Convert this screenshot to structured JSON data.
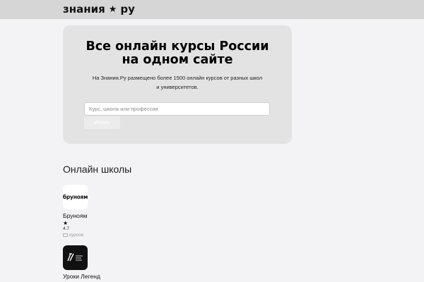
{
  "header": {
    "logo_left": "знания",
    "logo_star": "★",
    "logo_right": "ру"
  },
  "hero": {
    "title_line1": "Все онлайн курсы России",
    "title_line2": "на одном сайте",
    "subtitle": "На Знания.Ру размещено более 1500 онлайн курсов от разных школ и университетов.",
    "search_placeholder": "Курс, школа или профессия",
    "search_value": "",
    "button_label": "Искать"
  },
  "schools_section": {
    "title": "Онлайн школы",
    "items": [
      {
        "logo_text": "бруноям",
        "name": "Бруноям",
        "star": "★",
        "rating": "4.7",
        "courses_label": "курсов"
      },
      {
        "logo_text": "",
        "name": "Уроки Легенд",
        "star": "★"
      }
    ]
  },
  "colors": {
    "page_bg": "#f3f3f5",
    "header_bg": "#d6d6d6",
    "hero_bg": "#e3e3e3"
  }
}
